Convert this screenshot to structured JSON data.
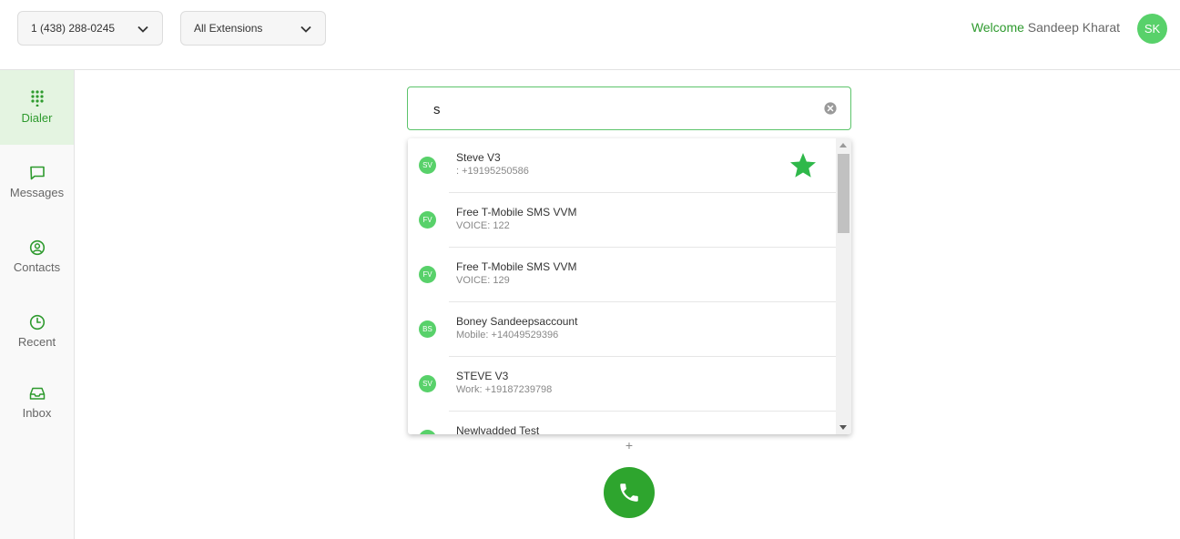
{
  "header": {
    "number_select": "1 (438) 288-0245",
    "extension_select": "All Extensions",
    "welcome_label": "Welcome",
    "user_name": "Sandeep Kharat",
    "avatar_initials": "SK"
  },
  "sidebar": {
    "items": [
      {
        "label": "Dialer",
        "icon": "dialpad-icon",
        "active": true
      },
      {
        "label": "Messages",
        "icon": "message-icon"
      },
      {
        "label": "Contacts",
        "icon": "contact-icon"
      },
      {
        "label": "Recent",
        "icon": "clock-icon"
      },
      {
        "label": "Inbox",
        "icon": "inbox-icon"
      }
    ]
  },
  "search": {
    "value": "s"
  },
  "results": [
    {
      "initials": "SV",
      "name": "Steve V3",
      "detail": ": +19195250586",
      "favorite": true
    },
    {
      "initials": "FV",
      "name": "Free T-Mobile SMS VVM",
      "detail": "VOICE: 122"
    },
    {
      "initials": "FV",
      "name": "Free T-Mobile SMS VVM",
      "detail": "VOICE: 129"
    },
    {
      "initials": "BS",
      "name": "Boney Sandeepsaccount",
      "detail": "Mobile: +14049529396"
    },
    {
      "initials": "SV",
      "name": "STEVE V3",
      "detail": "Work: +19187239798"
    },
    {
      "initials": "NT",
      "name": "Newlyadded Test",
      "detail": ""
    }
  ],
  "dialer": {
    "plus_label": "+"
  },
  "colors": {
    "accent": "#2ea52e",
    "avatar": "#58d16a",
    "star": "#2fb84a"
  }
}
